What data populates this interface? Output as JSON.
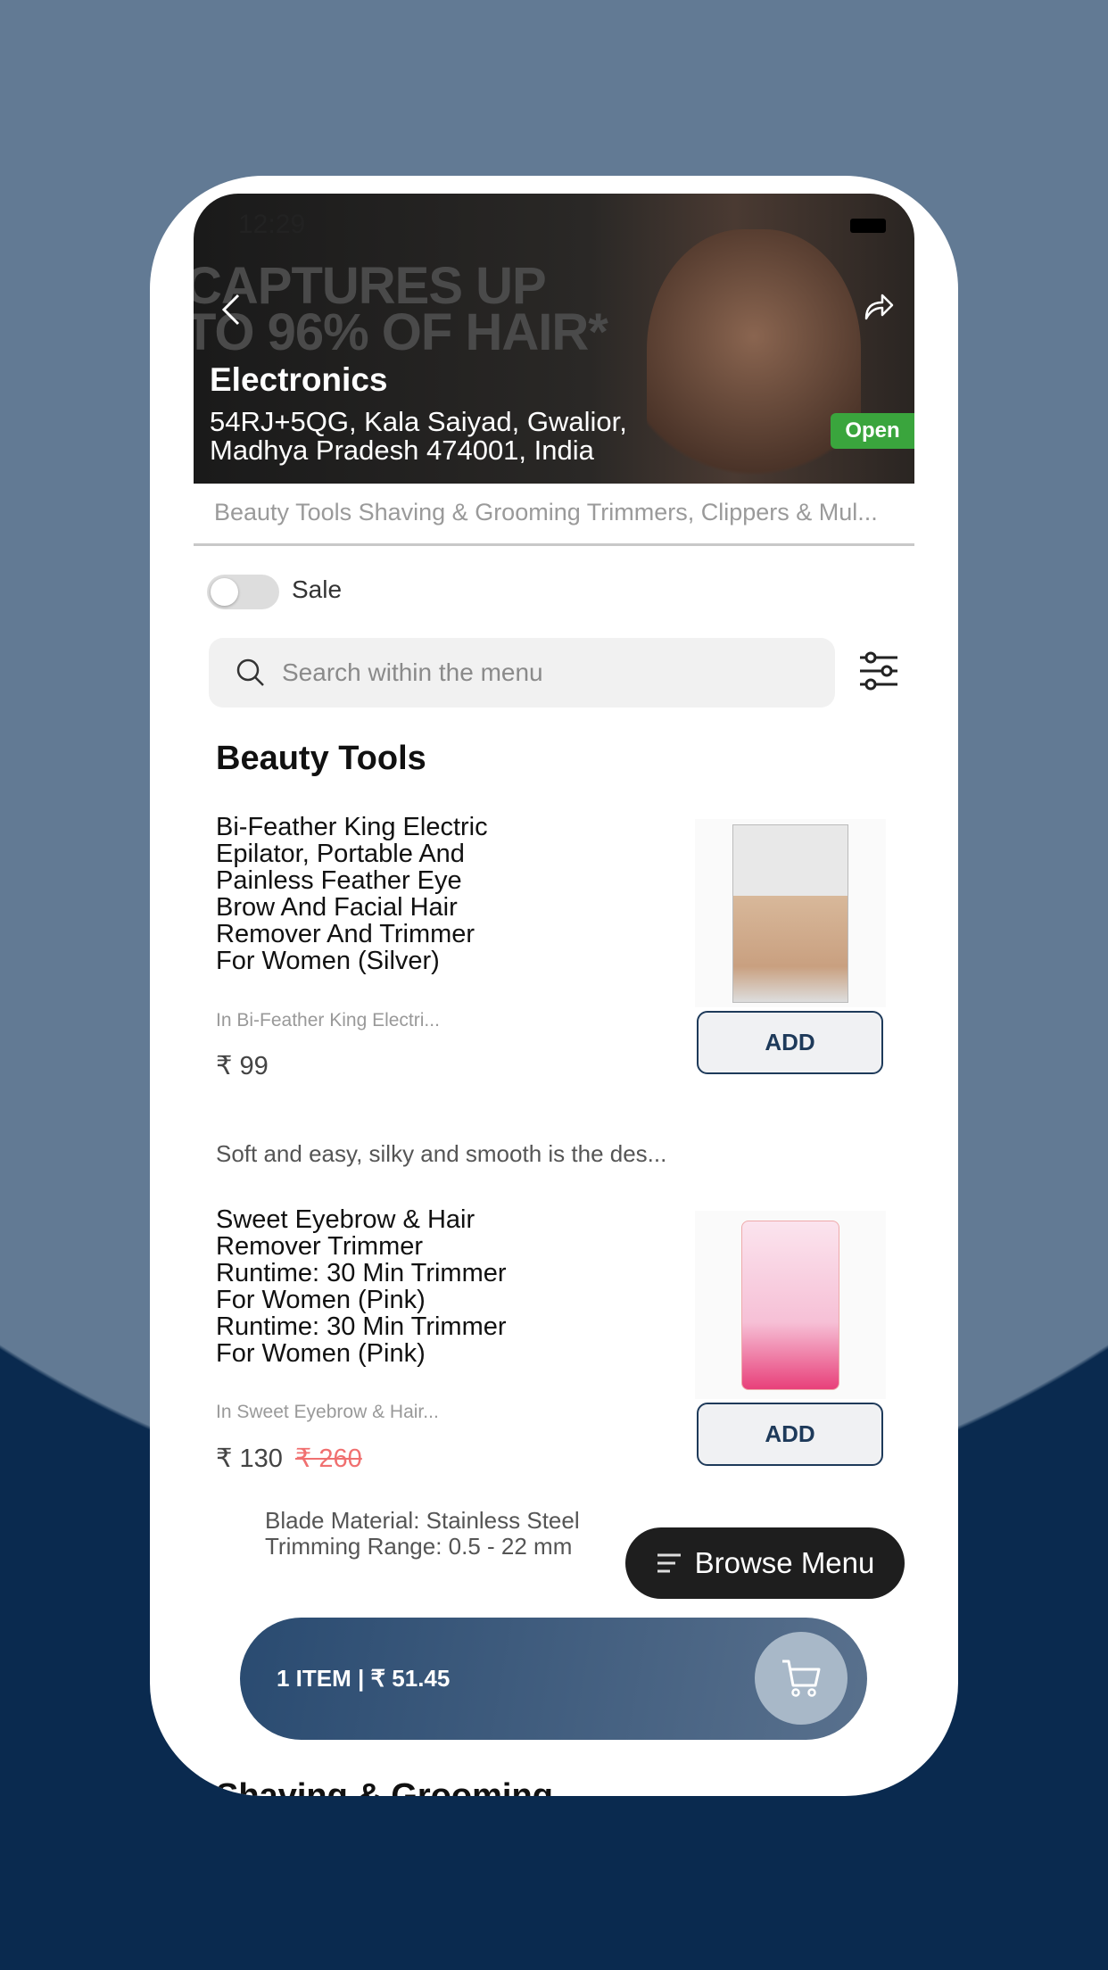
{
  "status_bar": {
    "time": "12:29"
  },
  "banner": {
    "promo_line1": "CAPTURES UP",
    "promo_line2": "TO 96% OF HAIR*",
    "store_name": "Electronics",
    "address_line1": "54RJ+5QG, Kala Saiyad, Gwalior,",
    "address_line2": "Madhya Pradesh 474001, India",
    "status": "Open",
    "status_color": "#3aa53d"
  },
  "categories_text": "Beauty Tools Shaving & Grooming Trimmers, Clippers & Mul...",
  "filters": {
    "sale_label": "Sale",
    "sale_on": false
  },
  "search": {
    "placeholder": "Search within the menu"
  },
  "sections": [
    {
      "title": "Beauty Tools",
      "items": [
        {
          "title": "Bi-Feather King Electric Epilator, Portable And Painless Feather Eye Brow And Facial Hair Remover And Trimmer For Women (Silver)",
          "subtitle": "In Bi-Feather King Electri...",
          "price": "₹ 99",
          "add_label": "ADD",
          "description": "Soft and easy, silky and smooth is the des..."
        },
        {
          "title": "Sweet Eyebrow & Hair Remover Trimmer Runtime: 30 Min Trimmer For Women (Pink) Runtime: 30 Min Trimmer For Women (Pink)",
          "subtitle": "In Sweet Eyebrow & Hair...",
          "price": "₹ 130",
          "original_price": "₹ 260",
          "add_label": "ADD",
          "description_line1": "Blade Material: Stainless Steel",
          "description_line2": "Trimming Range: 0.5 - 22 mm"
        }
      ]
    },
    {
      "title": "Shaving & Grooming"
    }
  ],
  "browse_menu": {
    "label": "Browse Menu"
  },
  "cart": {
    "summary": "1 ITEM | ₹ 51.45",
    "accent": "#1e3a5a"
  }
}
